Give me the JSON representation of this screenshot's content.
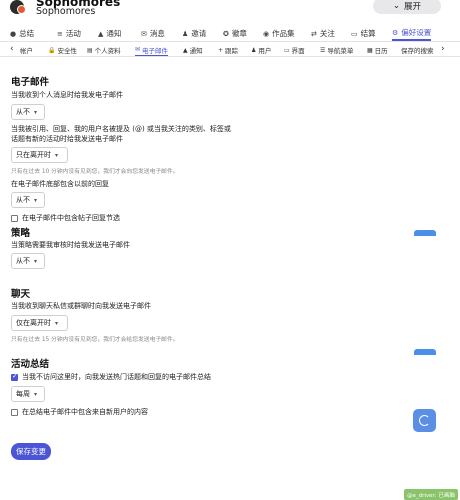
{
  "header": {
    "title": "Sophomores",
    "subtitle": "Sophomores",
    "expand_label": "展开",
    "expand_icon": "chevron-down-icon"
  },
  "tabs_primary": [
    {
      "label": "总结",
      "icon": "person-icon"
    },
    {
      "label": "活动",
      "icon": "stream-icon"
    },
    {
      "label": "通知",
      "icon": "bell-icon"
    },
    {
      "label": "消息",
      "icon": "envelope-icon"
    },
    {
      "label": "邀请",
      "icon": "user-plus-icon"
    },
    {
      "label": "徽章",
      "icon": "certificate-icon"
    },
    {
      "label": "作品集",
      "icon": "palette-icon"
    },
    {
      "label": "关注",
      "icon": "follow-icon"
    },
    {
      "label": "结算",
      "icon": "credit-card-icon"
    },
    {
      "label": "偏好设置",
      "icon": "gear-icon",
      "active": true
    }
  ],
  "tabs_secondary": [
    {
      "label": "帐户",
      "icon": ""
    },
    {
      "label": "安全性",
      "icon": "lock-icon"
    },
    {
      "label": "个人资料",
      "icon": "id-card-icon"
    },
    {
      "label": "电子邮件",
      "icon": "envelope-icon",
      "active": true
    },
    {
      "label": "通知",
      "icon": "bell-icon"
    },
    {
      "label": "跟踪",
      "icon": "plus-icon"
    },
    {
      "label": "用户",
      "icon": "users-icon"
    },
    {
      "label": "界面",
      "icon": "desktop-icon"
    },
    {
      "label": "导航菜单",
      "icon": "bars-icon"
    },
    {
      "label": "日历",
      "icon": "calendar-icon"
    },
    {
      "label": "保存的搜索",
      "icon": ""
    }
  ],
  "email": {
    "title": "电子邮件",
    "personal_label": "当我收到个人消息时给我发电子邮件",
    "personal_value": "从不",
    "mention_label_1": "当我被引用、回复、我的用户名被提及 (@) 或当我关注的类别、标签或",
    "mention_label_2": "话题有新的活动时给我发送电子邮件",
    "mention_value": "只在离开时",
    "mention_hint": "只有在过去 10 分钟内没有见到您，我们才会向您发送电子邮件。",
    "previous_label": "在电子邮件底部包含以前的回复",
    "previous_value": "从不",
    "include_excerpt_label": "在电子邮件中包含帖子回复节选"
  },
  "policy": {
    "title": "策略",
    "label": "当策略需要我审核时给我发送电子邮件",
    "value": "从不"
  },
  "chat": {
    "title": "聊天",
    "label": "当我收到聊天私信或群聊时向我发送电子邮件",
    "value": "仅在离开时",
    "hint": "只有在过去 15 分钟内没有见到您，我们才会给您发送电子邮件。"
  },
  "digest": {
    "title": "活动总结",
    "enable_label": "当我不访问这里时，向我发送热门话题和回复的电子邮件总结",
    "frequency_value": "每周",
    "new_users_label": "在总结电子邮件中包含来自新用户的内容"
  },
  "save_label": "保存变更",
  "watermark": "@e_driver: 已画脑",
  "colors": {
    "accent": "#4b55d6",
    "float_button": "#5b8fe6"
  }
}
